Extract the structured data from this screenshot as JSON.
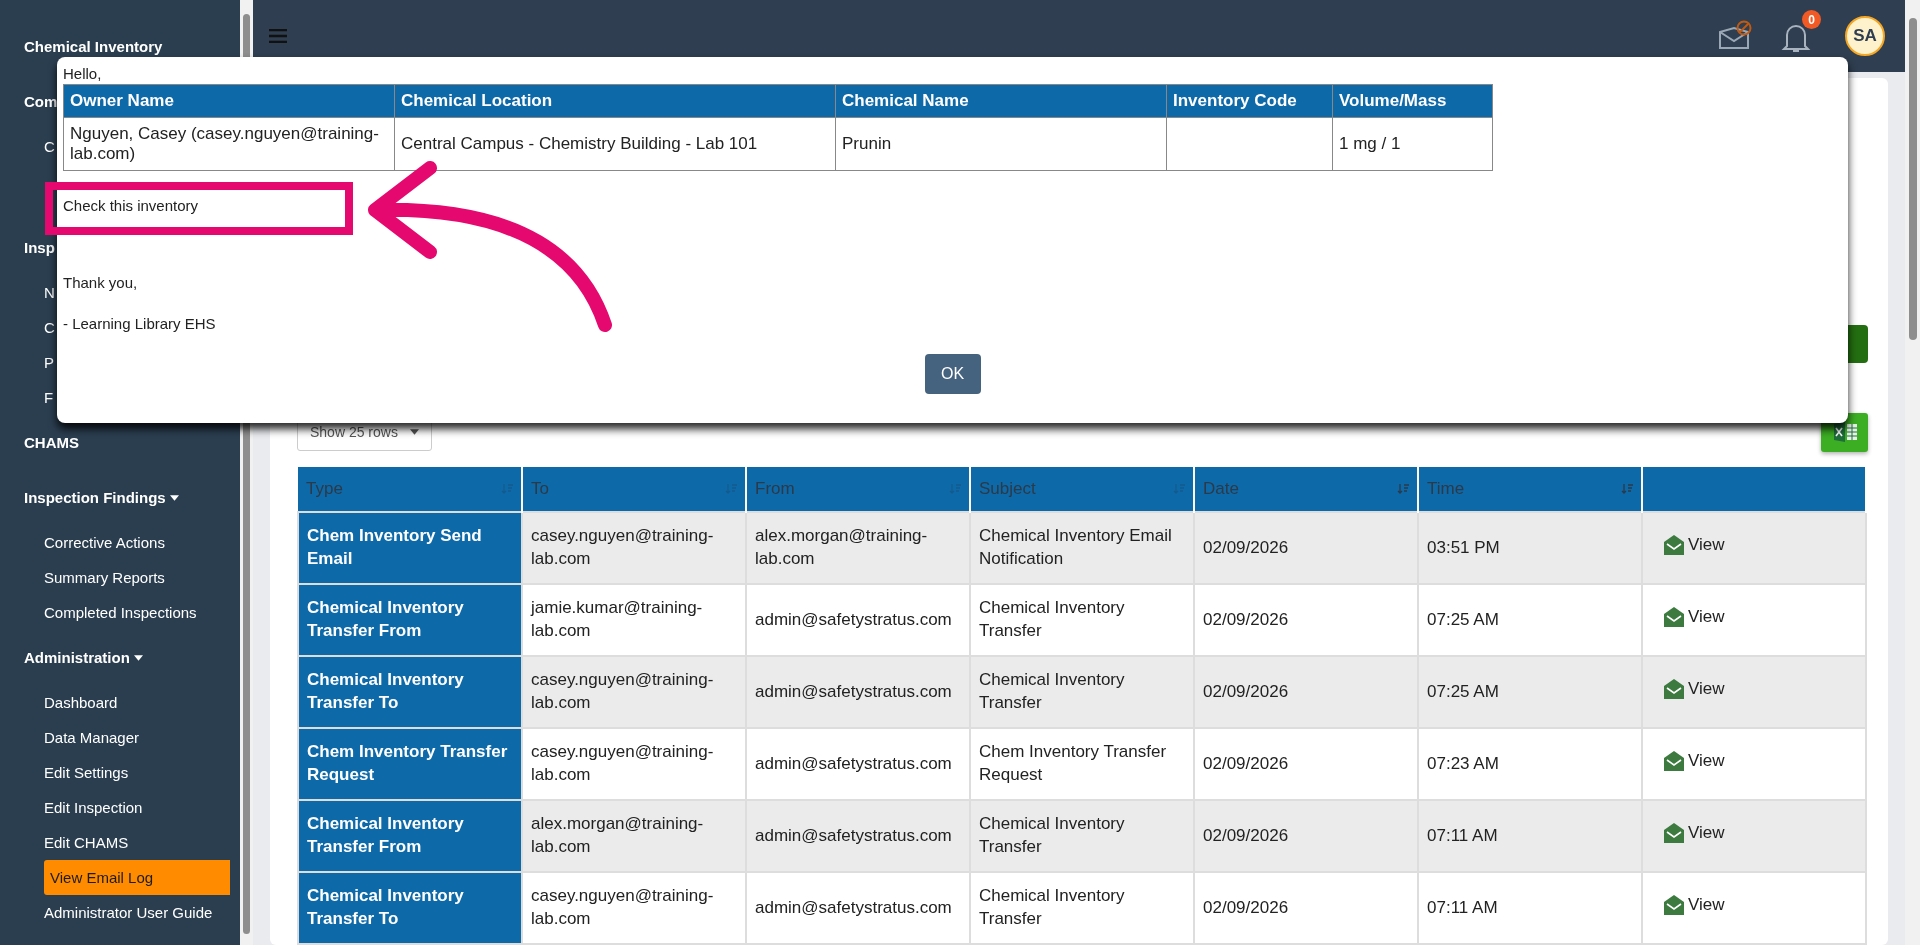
{
  "sidebar": {
    "items": [
      {
        "label": "Chemical Inventory",
        "kind": "heading",
        "selected": false
      },
      {
        "label": "Com",
        "kind": "heading",
        "selected": false
      },
      {
        "label": "C",
        "kind": "link",
        "selected": false
      },
      {
        "label": "Insp",
        "kind": "heading",
        "selected": false
      },
      {
        "label": "N",
        "kind": "link",
        "selected": false
      },
      {
        "label": "C",
        "kind": "link",
        "selected": false
      },
      {
        "label": "P",
        "kind": "link",
        "selected": false
      },
      {
        "label": "F",
        "kind": "link",
        "selected": false
      },
      {
        "label": "CHAMS",
        "kind": "heading",
        "selected": false
      },
      {
        "label": "Inspection Findings",
        "kind": "group",
        "selected": false
      },
      {
        "label": "Corrective Actions",
        "kind": "link",
        "selected": false
      },
      {
        "label": "Summary Reports",
        "kind": "link",
        "selected": false
      },
      {
        "label": "Completed Inspections",
        "kind": "link",
        "selected": false
      },
      {
        "label": "Administration",
        "kind": "group",
        "selected": false
      },
      {
        "label": "Dashboard",
        "kind": "link",
        "selected": false
      },
      {
        "label": "Data Manager",
        "kind": "link",
        "selected": false
      },
      {
        "label": "Edit Settings",
        "kind": "link",
        "selected": false
      },
      {
        "label": "Edit Inspection",
        "kind": "link",
        "selected": false
      },
      {
        "label": "Edit CHAMS",
        "kind": "link",
        "selected": false
      },
      {
        "label": "View Email Log",
        "kind": "link",
        "selected": true
      },
      {
        "label": "Administrator User Guide",
        "kind": "link",
        "selected": false
      }
    ]
  },
  "topbar": {
    "notification_count": "0",
    "avatar": "SA"
  },
  "modal": {
    "greeting": "Hello,",
    "table": {
      "columns": [
        "Owner Name",
        "Chemical Location",
        "Chemical Name",
        "Inventory Code",
        "Volume/Mass"
      ],
      "rows": [
        [
          "Nguyen, Casey (casey.nguyen@training-lab.com)",
          "Central Campus - Chemistry Building - Lab 101",
          "Prunin",
          null,
          "1 mg / 1"
        ]
      ]
    },
    "message": "Check this inventory",
    "closing": "Thank you,",
    "signature": "- Learning Library EHS",
    "button": "OK"
  },
  "rows_select": "Show 25 rows",
  "table": {
    "columns": [
      {
        "label": "Type",
        "sorted": false
      },
      {
        "label": "To",
        "sorted": false
      },
      {
        "label": "From",
        "sorted": false
      },
      {
        "label": "Subject",
        "sorted": false
      },
      {
        "label": "Date",
        "sorted": true
      },
      {
        "label": "Time",
        "sorted": true
      }
    ],
    "rows": [
      {
        "type": "Chem Inventory Send Email",
        "to": "casey.nguyen@training-lab.com",
        "from": "alex.morgan@training-lab.com",
        "subject": "Chemical Inventory Email Notification",
        "date": "02/09/2026",
        "time": "03:51 PM",
        "action": "View"
      },
      {
        "type": "Chemical Inventory Transfer From",
        "to": "jamie.kumar@training-lab.com",
        "from": "admin@safetystratus.com",
        "subject": "Chemical Inventory Transfer",
        "date": "02/09/2026",
        "time": "07:25 AM",
        "action": "View"
      },
      {
        "type": "Chemical Inventory Transfer To",
        "to": "casey.nguyen@training-lab.com",
        "from": "admin@safetystratus.com",
        "subject": "Chemical Inventory Transfer",
        "date": "02/09/2026",
        "time": "07:25 AM",
        "action": "View"
      },
      {
        "type": "Chem Inventory Transfer Request",
        "to": "casey.nguyen@training-lab.com",
        "from": "admin@safetystratus.com",
        "subject": "Chem Inventory Transfer Request",
        "date": "02/09/2026",
        "time": "07:23 AM",
        "action": "View"
      },
      {
        "type": "Chemical Inventory Transfer From",
        "to": "alex.morgan@training-lab.com",
        "from": "admin@safetystratus.com",
        "subject": "Chemical Inventory Transfer",
        "date": "02/09/2026",
        "time": "07:11 AM",
        "action": "View"
      },
      {
        "type": "Chemical Inventory Transfer To",
        "to": "casey.nguyen@training-lab.com",
        "from": "admin@safetystratus.com",
        "subject": "Chemical Inventory Transfer",
        "date": "02/09/2026",
        "time": "07:11 AM",
        "action": "View"
      }
    ]
  }
}
